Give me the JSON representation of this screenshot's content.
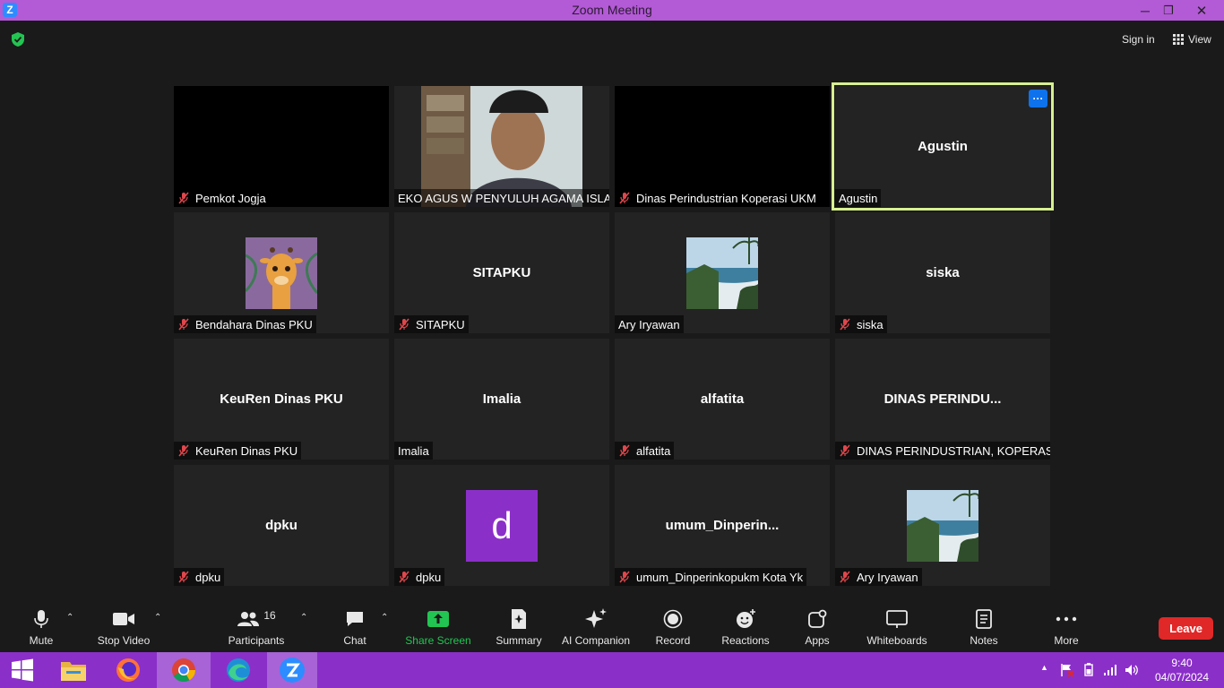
{
  "window": {
    "title": "Zoom Meeting",
    "logo_letter": "Z",
    "icons": [
      "minimize-icon",
      "restore-icon",
      "close-icon"
    ],
    "glyphs": {
      "minimize": "─",
      "restore": "❐",
      "close": "✕"
    }
  },
  "topbar": {
    "sign_in_label": "Sign in",
    "view_label": "View"
  },
  "participants": [
    {
      "display_name": "Pemkot Jogja",
      "center_name": "",
      "muted": true,
      "video": "black"
    },
    {
      "display_name": "EKO AGUS W PENYULUH AGAMA ISLA...",
      "center_name": "",
      "muted": false,
      "video": "camera"
    },
    {
      "display_name": "Dinas Perindustrian Koperasi UKM",
      "center_name": "",
      "muted": true,
      "video": "black"
    },
    {
      "display_name": "Agustin",
      "center_name": "Agustin",
      "muted": false,
      "video": "off",
      "active_speaker": true
    },
    {
      "display_name": "Bendahara Dinas PKU",
      "center_name": "",
      "muted": true,
      "video": "giraffe-avatar"
    },
    {
      "display_name": "SITAPKU",
      "center_name": "SITAPKU",
      "muted": true,
      "video": "off"
    },
    {
      "display_name": "Ary Iryawan",
      "center_name": "",
      "muted": false,
      "video": "beach-avatar"
    },
    {
      "display_name": "siska",
      "center_name": "siska",
      "muted": true,
      "video": "off"
    },
    {
      "display_name": "KeuRen Dinas PKU",
      "center_name": "KeuRen Dinas PKU",
      "muted": true,
      "video": "off"
    },
    {
      "display_name": "Imalia",
      "center_name": "Imalia",
      "muted": false,
      "video": "off"
    },
    {
      "display_name": "alfatita",
      "center_name": "alfatita",
      "muted": true,
      "video": "off"
    },
    {
      "display_name": "DINAS PERINDUSTRIAN, KOPERASI,...",
      "center_name": "DINAS  PERINDU...",
      "muted": true,
      "video": "off"
    },
    {
      "display_name": "dpku",
      "center_name": "dpku",
      "muted": true,
      "video": "off"
    },
    {
      "display_name": "dpku",
      "center_name": "",
      "muted": true,
      "video": "letter-avatar",
      "avatar_letter": "d"
    },
    {
      "display_name": "umum_Dinperinkopukm Kota Yk",
      "center_name": "umum_Dinperin...",
      "muted": true,
      "video": "off"
    },
    {
      "display_name": "Ary Iryawan",
      "center_name": "",
      "muted": true,
      "video": "beach-avatar"
    }
  ],
  "tile_menu_label": "···",
  "toolbar": {
    "mute": "Mute",
    "stop_video": "Stop Video",
    "participants": "Participants",
    "participants_count": "16",
    "chat": "Chat",
    "share_screen": "Share Screen",
    "summary": "Summary",
    "ai_companion": "AI Companion",
    "record": "Record",
    "reactions": "Reactions",
    "apps": "Apps",
    "whiteboards": "Whiteboards",
    "notes": "Notes",
    "more": "More",
    "leave": "Leave",
    "caret": "⌃"
  },
  "taskbar": {
    "apps": [
      "windows-start",
      "file-explorer",
      "firefox",
      "chrome",
      "edge",
      "zoom"
    ],
    "time": "9:40",
    "date": "04/07/2024",
    "tray_arrow": "▲"
  },
  "colors": {
    "title_bar": "#b35ad6",
    "taskbar": "#8b2fc9",
    "active_speaker_border": "#d7f090",
    "share_green": "#23c552",
    "leave_red": "#e02828",
    "muted_red": "#e0474c"
  }
}
